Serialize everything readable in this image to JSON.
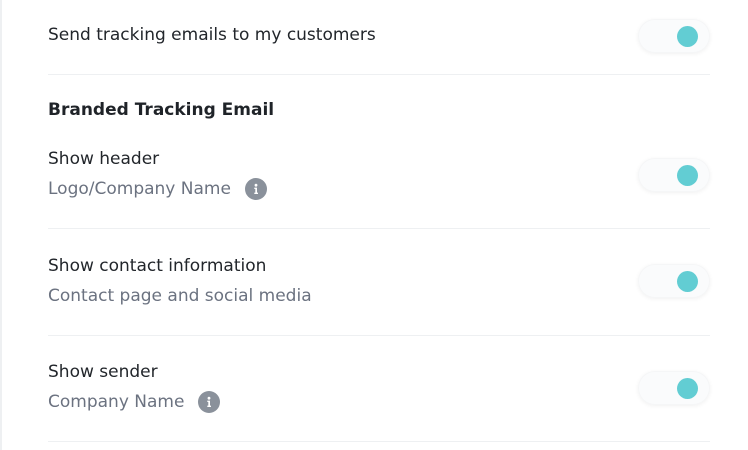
{
  "settings": {
    "send_tracking": {
      "label": "Send tracking emails to my customers",
      "enabled": true
    },
    "section_heading": "Branded Tracking Email",
    "show_header": {
      "label": "Show header",
      "sublabel": "Logo/Company Name",
      "enabled": true,
      "has_info_icon": true
    },
    "show_contact": {
      "label": "Show contact information",
      "sublabel": "Contact page and social media",
      "enabled": true
    },
    "show_sender": {
      "label": "Show sender",
      "sublabel": "Company Name",
      "enabled": true,
      "has_info_icon": true
    }
  },
  "colors": {
    "toggle_on": "#62cdd3",
    "info_icon": "#8a919b",
    "divider": "#eef0f2"
  },
  "icons": {
    "info": "info-icon"
  }
}
